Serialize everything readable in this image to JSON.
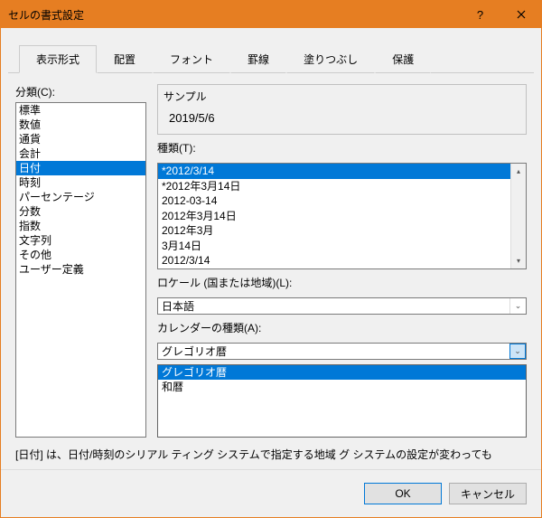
{
  "titlebar": {
    "title": "セルの書式設定"
  },
  "tabs": {
    "items": [
      "表示形式",
      "配置",
      "フォント",
      "罫線",
      "塗りつぶし",
      "保護"
    ],
    "active": 0
  },
  "category": {
    "label": "分類(C):",
    "items": [
      "標準",
      "数値",
      "通貨",
      "会計",
      "日付",
      "時刻",
      "パーセンテージ",
      "分数",
      "指数",
      "文字列",
      "その他",
      "ユーザー定義"
    ],
    "selected": 4
  },
  "sample": {
    "label": "サンプル",
    "value": "2019/5/6"
  },
  "type": {
    "label": "種類(T):",
    "items": [
      "*2012/3/14",
      "*2012年3月14日",
      "2012-03-14",
      "2012年3月14日",
      "2012年3月",
      "3月14日",
      "2012/3/14"
    ],
    "selected": 0
  },
  "locale": {
    "label": "ロケール (国または地域)(L):",
    "value": "日本語"
  },
  "calendar": {
    "label": "カレンダーの種類(A):",
    "value": "グレゴリオ暦",
    "options": [
      "グレゴリオ暦",
      "和暦"
    ],
    "highlighted": 0
  },
  "description": "[日付] は、日付/時刻のシリアル\nティング システムで指定する地域\nグ システムの設定が変わっても",
  "footer": {
    "ok": "OK",
    "cancel": "キャンセル"
  }
}
